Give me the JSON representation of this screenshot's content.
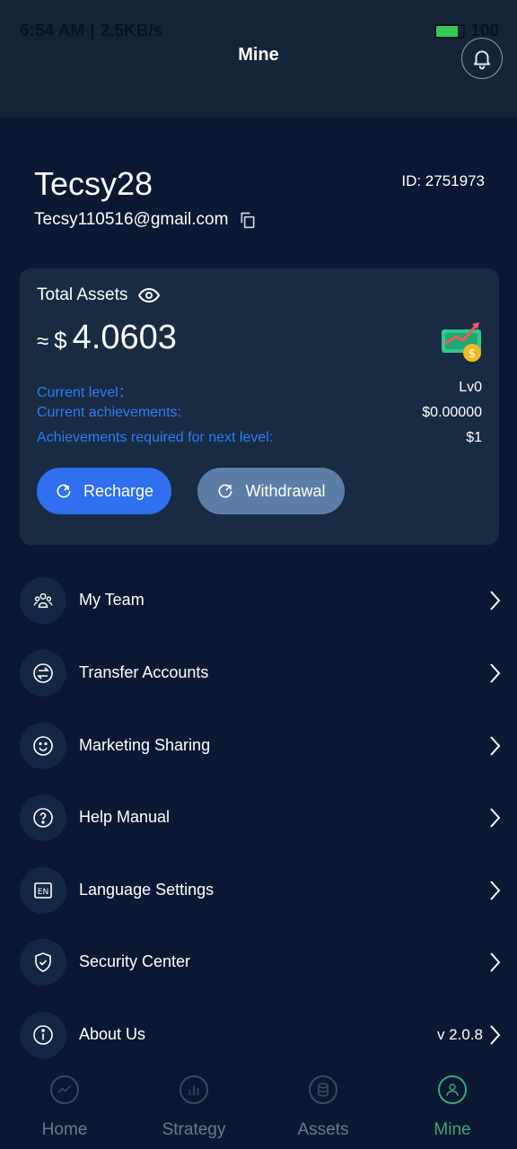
{
  "status_bar": {
    "time": "6:54 AM",
    "speed": "2.5KB/s",
    "battery": "100"
  },
  "header": {
    "title": "Mine",
    "notification_icon": "bell-icon"
  },
  "user": {
    "name": "Tecsy28",
    "id_label": "ID: 2751973",
    "email": "Tecsy110516@gmail.com",
    "copy_icon": "copy-icon"
  },
  "assets": {
    "label": "Total Assets",
    "approx": "≈",
    "currency": "$",
    "value": "4.0603",
    "rows": [
      {
        "key": "Current level：",
        "value": "Lv0"
      },
      {
        "key": "Current achievements:",
        "value": "$0.00000"
      },
      {
        "key": "Achievements required for next level:",
        "value": "$1"
      }
    ],
    "recharge_label": "Recharge",
    "withdraw_label": "Withdrawal"
  },
  "menu": {
    "items": [
      {
        "label": "My Team",
        "icon": "team-icon"
      },
      {
        "label": "Transfer Accounts",
        "icon": "transfer-icon"
      },
      {
        "label": "Marketing Sharing",
        "icon": "smile-icon"
      },
      {
        "label": "Help Manual",
        "icon": "help-icon"
      },
      {
        "label": "Language Settings",
        "icon": "language-icon"
      },
      {
        "label": "Security Center",
        "icon": "shield-icon"
      },
      {
        "label": "About Us",
        "icon": "info-icon",
        "value": "v 2.0.8"
      }
    ]
  },
  "tabbar": {
    "tabs": [
      {
        "label": "Home",
        "icon": "chart-line-icon",
        "active": false
      },
      {
        "label": "Strategy",
        "icon": "bar-chart-icon",
        "active": false
      },
      {
        "label": "Assets",
        "icon": "coins-icon",
        "active": false
      },
      {
        "label": "Mine",
        "icon": "user-icon",
        "active": true
      }
    ]
  },
  "colors": {
    "background": "#0b1833",
    "accent_blue": "#2f7cf6",
    "active_tab": "#3fa374"
  }
}
